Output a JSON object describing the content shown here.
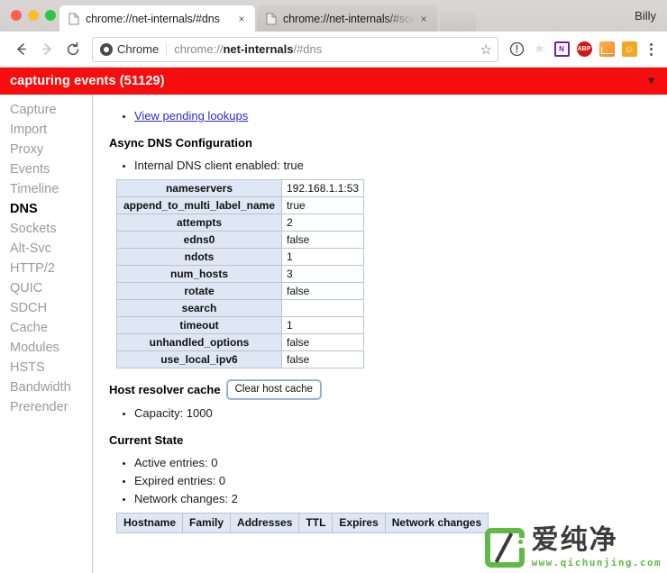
{
  "window": {
    "profile_name": "Billy",
    "traffic_lights": [
      "close-red",
      "minimize-yellow",
      "maximize-green"
    ]
  },
  "tabs": [
    {
      "title": "chrome://net-internals/#dns",
      "active": true,
      "close_label": "×",
      "favicon": "page-icon"
    },
    {
      "title": "chrome://net-internals/#socke",
      "active": false,
      "close_label": "×",
      "favicon": "page-icon"
    }
  ],
  "toolbar": {
    "back_icon": "←",
    "forward_icon": "→",
    "reload_icon": "⟳",
    "security_chip": "Chrome",
    "url_prefix": "chrome://",
    "url_bold": "net-internals",
    "url_suffix": "/#dns",
    "star_icon": "☆",
    "info_icon": "ⓘ",
    "extensions": [
      {
        "name": "onenote-extension",
        "label": "N"
      },
      {
        "name": "adblock-plus-extension",
        "label": "ABP"
      },
      {
        "name": "chart-extension",
        "label": ""
      },
      {
        "name": "pumpkin-extension",
        "label": "☺"
      }
    ],
    "menu_icon": "three-dot-menu"
  },
  "banner": {
    "text": "capturing events (51129)",
    "arrow": "▼",
    "color": "#f60d0d"
  },
  "sidebar": {
    "items": [
      {
        "label": "Capture",
        "selected": false
      },
      {
        "label": "Import",
        "selected": false
      },
      {
        "label": "Proxy",
        "selected": false
      },
      {
        "label": "Events",
        "selected": false
      },
      {
        "label": "Timeline",
        "selected": false
      },
      {
        "label": "DNS",
        "selected": true
      },
      {
        "label": "Sockets",
        "selected": false
      },
      {
        "label": "Alt-Svc",
        "selected": false
      },
      {
        "label": "HTTP/2",
        "selected": false
      },
      {
        "label": "QUIC",
        "selected": false
      },
      {
        "label": "SDCH",
        "selected": false
      },
      {
        "label": "Cache",
        "selected": false
      },
      {
        "label": "Modules",
        "selected": false
      },
      {
        "label": "HSTS",
        "selected": false
      },
      {
        "label": "Bandwidth",
        "selected": false
      },
      {
        "label": "Prerender",
        "selected": false
      }
    ]
  },
  "main": {
    "pending_lookups_link": "View pending lookups",
    "async_dns_heading": "Async DNS Configuration",
    "internal_client_line": "Internal DNS client enabled: true",
    "config_table": {
      "rows": [
        {
          "key": "nameservers",
          "value": "192.168.1.1:53"
        },
        {
          "key": "append_to_multi_label_name",
          "value": "true"
        },
        {
          "key": "attempts",
          "value": "2"
        },
        {
          "key": "edns0",
          "value": "false"
        },
        {
          "key": "ndots",
          "value": "1"
        },
        {
          "key": "num_hosts",
          "value": "3"
        },
        {
          "key": "rotate",
          "value": "false"
        },
        {
          "key": "search",
          "value": ""
        },
        {
          "key": "timeout",
          "value": "1"
        },
        {
          "key": "unhandled_options",
          "value": "false"
        },
        {
          "key": "use_local_ipv6",
          "value": "false"
        }
      ]
    },
    "host_resolver_heading": "Host resolver cache",
    "clear_host_cache_button": "Clear host cache",
    "capacity_line": "Capacity: 1000",
    "current_state_heading": "Current State",
    "state_lines": [
      "Active entries: 0",
      "Expired entries: 0",
      "Network changes: 2"
    ],
    "cache_table_headers": [
      "Hostname",
      "Family",
      "Addresses",
      "TTL",
      "Expires",
      "Network changes"
    ]
  },
  "watermark": {
    "cn_text": "爱纯净",
    "url_text": "www.qichunjing.com",
    "accent": "#5fbb46"
  }
}
